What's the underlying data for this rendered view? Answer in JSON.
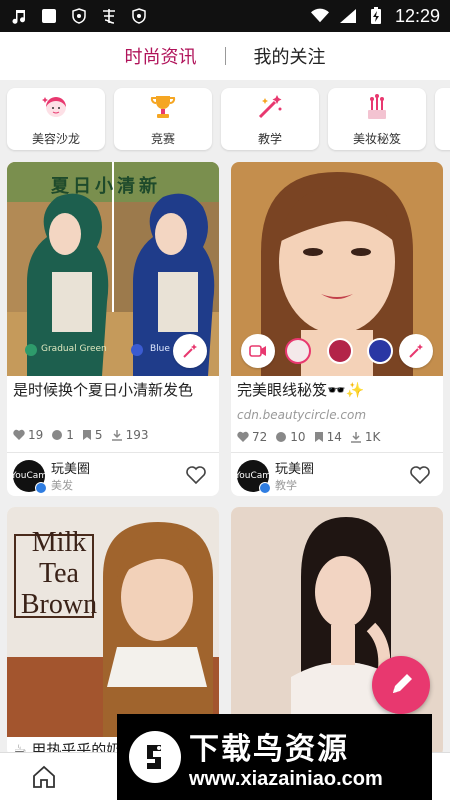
{
  "status_bar": {
    "time": "12:29"
  },
  "top_tabs": [
    {
      "label": "时尚资讯",
      "active": true
    },
    {
      "label": "我的关注",
      "active": false
    }
  ],
  "categories": [
    {
      "label": "美容沙龙",
      "icon": "salon-face-icon"
    },
    {
      "label": "竞赛",
      "icon": "trophy-icon"
    },
    {
      "label": "教学",
      "icon": "magic-wand-icon"
    },
    {
      "label": "美妆秘笈",
      "icon": "makeup-brushes-icon"
    }
  ],
  "feed": {
    "cards": [
      {
        "image_text": "夏日小清新",
        "image_left_label": "Gradual Green",
        "image_right_label": "Blue",
        "title": "是时候换个夏日小清新发色",
        "stats": {
          "likes": "19",
          "comments": "1",
          "saves": "5",
          "downloads": "193"
        },
        "author": {
          "name": "玩美圈",
          "category": "美发",
          "avatar_text": "YouCam"
        }
      },
      {
        "title": "完美眼线秘笈🕶️✨",
        "subtitle": "cdn.beautycircle.com",
        "stats": {
          "likes": "72",
          "comments": "10",
          "saves": "14",
          "downloads": "1K"
        },
        "author": {
          "name": "玩美圈",
          "category": "教学",
          "avatar_text": "YouCam"
        }
      },
      {
        "image_text_lines": [
          "Milk",
          "Tea",
          "Brown"
        ],
        "bottom_text": "☕ 用热乎乎的奶"
      },
      {}
    ]
  },
  "watermark": {
    "title": "下载鸟资源",
    "url": "www.xiazainiao.com"
  },
  "colors": {
    "accent": "#b0135a",
    "fab": "#e8386f"
  }
}
